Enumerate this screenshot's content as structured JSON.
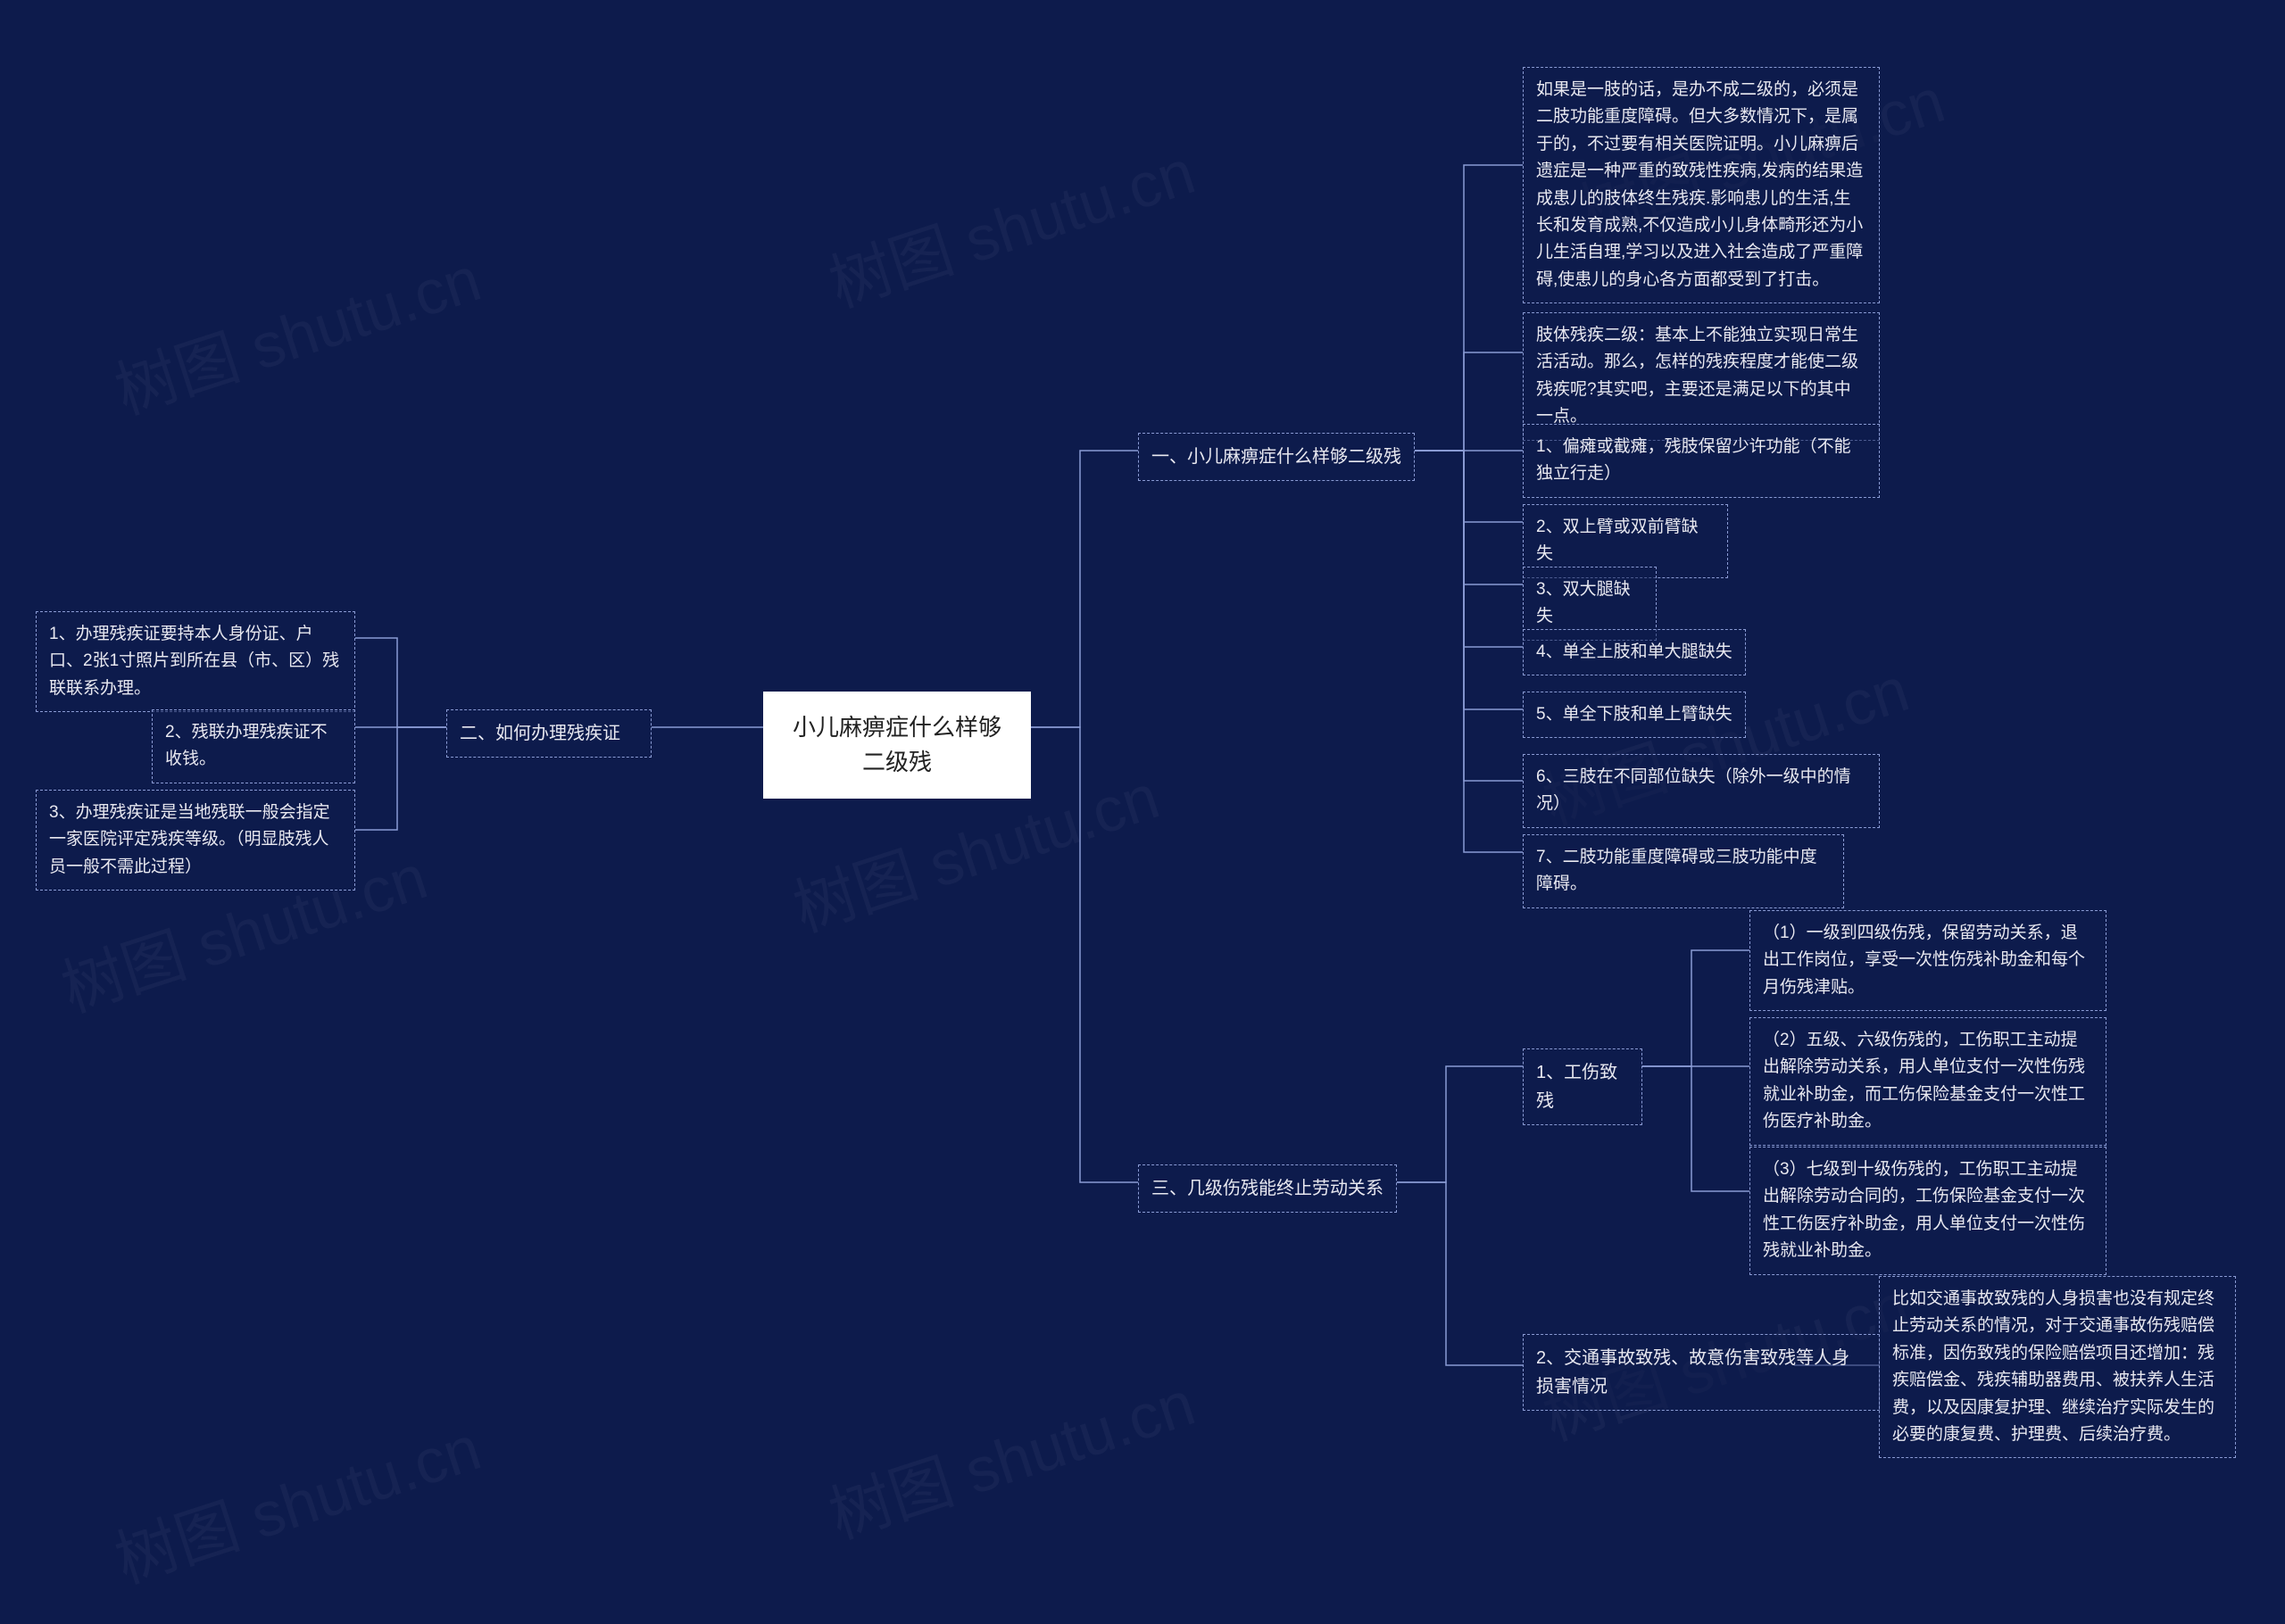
{
  "watermark": "树图 shutu.cn",
  "root": "小儿麻痹症什么样够二级残",
  "branch1": {
    "title": "一、小儿麻痹症什么样够二级残",
    "items": [
      "如果是一肢的话，是办不成二级的，必须是二肢功能重度障碍。但大多数情况下，是属于的，不过要有相关医院证明。小儿麻痹后遗症是一种严重的致残性疾病,发病的结果造成患儿的肢体终生残疾.影响患儿的生活,生长和发育成熟,不仅造成小儿身体畸形还为小儿生活自理,学习以及进入社会造成了严重障碍,使患儿的身心各方面都受到了打击。",
      "肢体残疾二级：基本上不能独立实现日常生活活动。那么，怎样的残疾程度才能使二级残疾呢?其实吧，主要还是满足以下的其中一点。",
      "1、偏瘫或截瘫，残肢保留少许功能（不能独立行走）",
      "2、双上臂或双前臂缺失",
      "3、双大腿缺失",
      "4、单全上肢和单大腿缺失",
      "5、单全下肢和单上臂缺失",
      "6、三肢在不同部位缺失（除外一级中的情况）",
      "7、二肢功能重度障碍或三肢功能中度障碍。"
    ]
  },
  "branch2": {
    "title": "二、如何办理残疾证",
    "items": [
      "1、办理残疾证要持本人身份证、户口、2张1寸照片到所在县（市、区）残联联系办理。",
      "2、残联办理残疾证不收钱。",
      "3、办理残疾证是当地残联一般会指定一家医院评定残疾等级。（明显肢残人员一般不需此过程）"
    ]
  },
  "branch3": {
    "title": "三、几级伤残能终止劳动关系",
    "sub1": {
      "title": "1、工伤致残",
      "items": [
        "（1）一级到四级伤残，保留劳动关系，退出工作岗位，享受一次性伤残补助金和每个月伤残津贴。",
        "（2）五级、六级伤残的，工伤职工主动提出解除劳动关系，用人单位支付一次性伤残就业补助金，而工伤保险基金支付一次性工伤医疗补助金。",
        "（3）七级到十级伤残的，工伤职工主动提出解除劳动合同的，工伤保险基金支付一次性工伤医疗补助金，用人单位支付一次性伤残就业补助金。"
      ]
    },
    "sub2": {
      "title": "2、交通事故致残、故意伤害致残等人身损害情况",
      "content": "比如交通事故致残的人身损害也没有规定终止劳动关系的情况，对于交通事故伤残赔偿标准，因伤致残的保险赔偿项目还增加：残疾赔偿金、残疾辅助器费用、被扶养人生活费，以及因康复护理、继续治疗实际发生的必要的康复费、护理费、后续治疗费。"
    }
  }
}
